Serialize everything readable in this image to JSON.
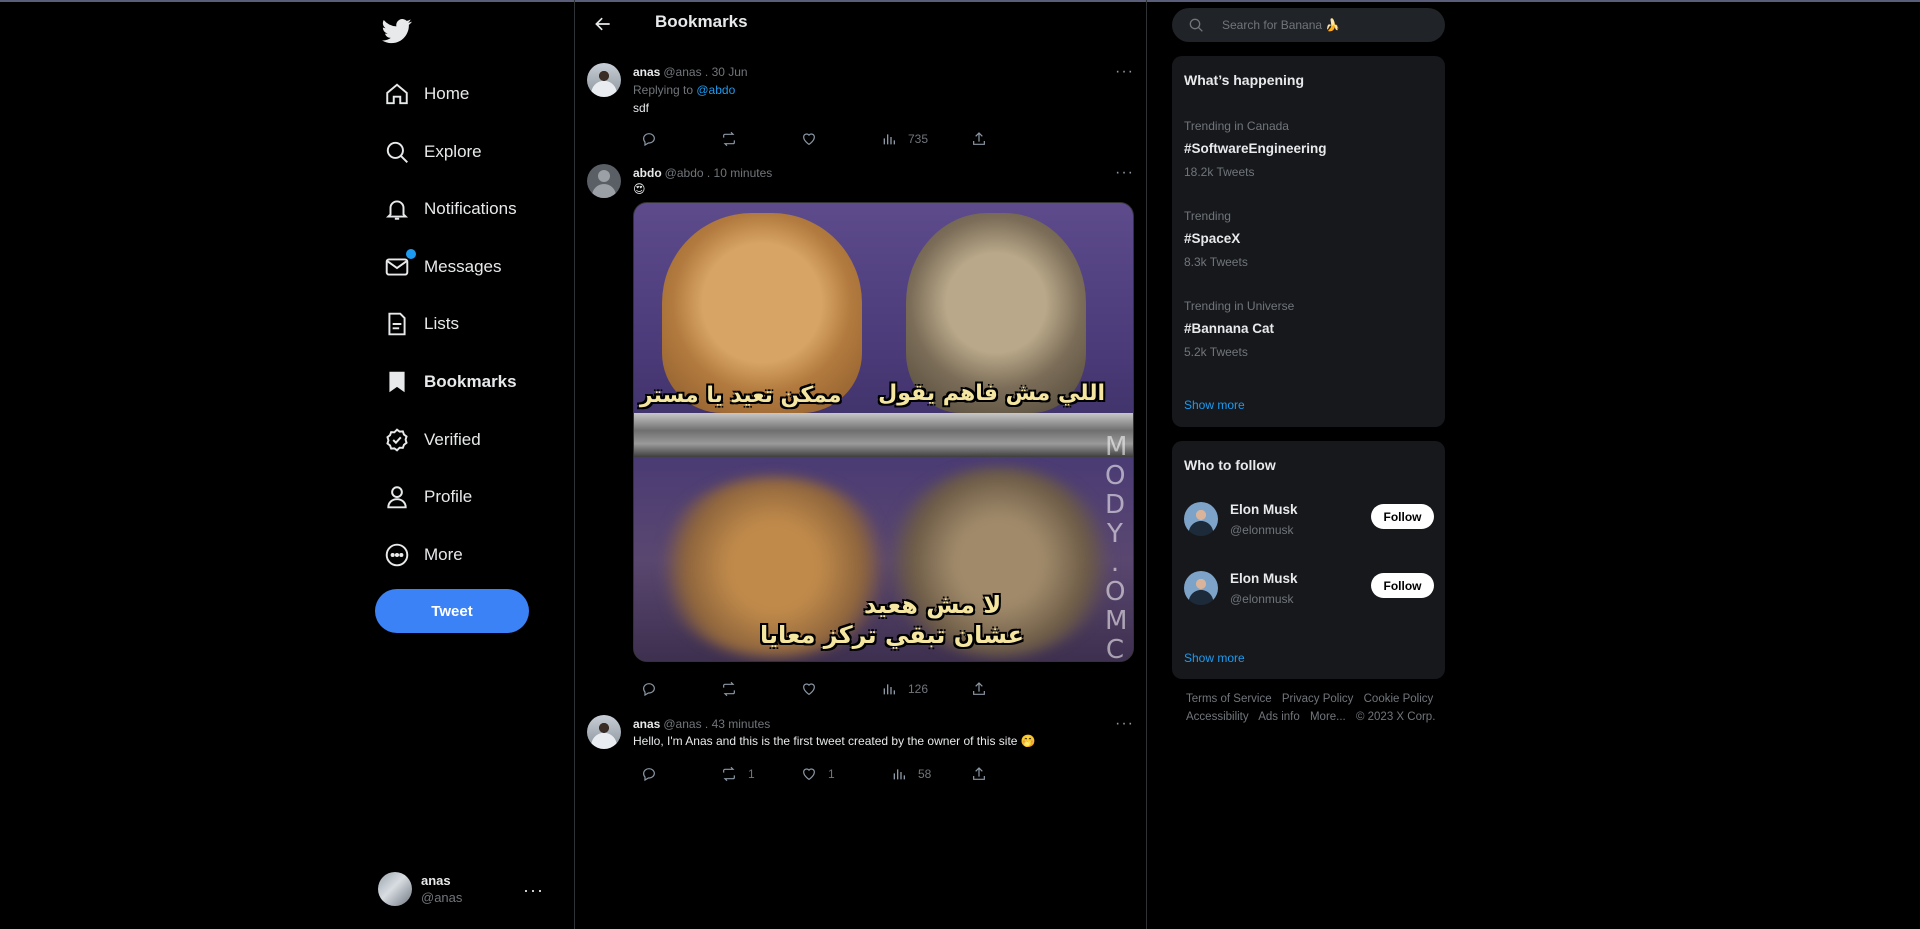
{
  "colors": {
    "accent": "#1d9bf0",
    "tweet_button": "#3b82f6",
    "background": "#000000",
    "panel": "#16181c"
  },
  "nav": {
    "items": [
      {
        "label": "Home",
        "icon": "home-icon"
      },
      {
        "label": "Explore",
        "icon": "search-icon"
      },
      {
        "label": "Notifications",
        "icon": "bell-icon"
      },
      {
        "label": "Messages",
        "icon": "mail-icon"
      },
      {
        "label": "Lists",
        "icon": "list-icon"
      },
      {
        "label": "Bookmarks",
        "icon": "bookmark-icon"
      },
      {
        "label": "Verified",
        "icon": "verified-icon"
      },
      {
        "label": "Profile",
        "icon": "profile-icon"
      },
      {
        "label": "More",
        "icon": "more-circle-icon"
      }
    ],
    "tweet_label": "Tweet",
    "account": {
      "name": "anas",
      "handle": "@anas"
    }
  },
  "header": {
    "title": "Bookmarks"
  },
  "tweets": [
    {
      "name": "anas",
      "handle": "@anas . 30 Jun",
      "replying_prefix": "Replying to ",
      "replying_to": "@abdo",
      "text": "sdf",
      "views": "735"
    },
    {
      "name": "abdo",
      "handle": "@abdo . 10 minutes",
      "text": "😍",
      "image": {
        "caption_top_right": "اللي مش فاهم يقول",
        "caption_top_left": "ممكن تعيد يا مستر",
        "caption_bottom_1": "لا مش هعيد",
        "caption_bottom_2": "عشان تبقي تركز معايا",
        "watermark": "MODY.OMCD"
      },
      "views": "126"
    },
    {
      "name": "anas",
      "handle": "@anas . 43 minutes",
      "text": "Hello, I'm Anas and this is the first tweet created by the owner of this site 🤭",
      "retweets": "1",
      "likes": "1",
      "views": "58"
    }
  ],
  "search": {
    "placeholder": "Search for Banana 🍌"
  },
  "trends": {
    "title": "What’s happening",
    "items": [
      {
        "context": "Trending in Canada",
        "tag": "#SoftwareEngineering",
        "count": "18.2k Tweets"
      },
      {
        "context": "Trending",
        "tag": "#SpaceX",
        "count": "8.3k Tweets"
      },
      {
        "context": "Trending in Universe",
        "tag": "#Bannana Cat",
        "count": "5.2k Tweets"
      }
    ],
    "show_more": "Show more"
  },
  "who_to_follow": {
    "title": "Who to follow",
    "items": [
      {
        "name": "Elon Musk",
        "handle": "@elonmusk",
        "button": "Follow"
      },
      {
        "name": "Elon Musk",
        "handle": "@elonmusk",
        "button": "Follow"
      }
    ],
    "show_more": "Show more"
  },
  "footer": {
    "links": [
      "Terms of Service",
      "Privacy Policy",
      "Cookie Policy",
      "Accessibility",
      "Ads info",
      "More...",
      "© 2023 X Corp."
    ]
  }
}
